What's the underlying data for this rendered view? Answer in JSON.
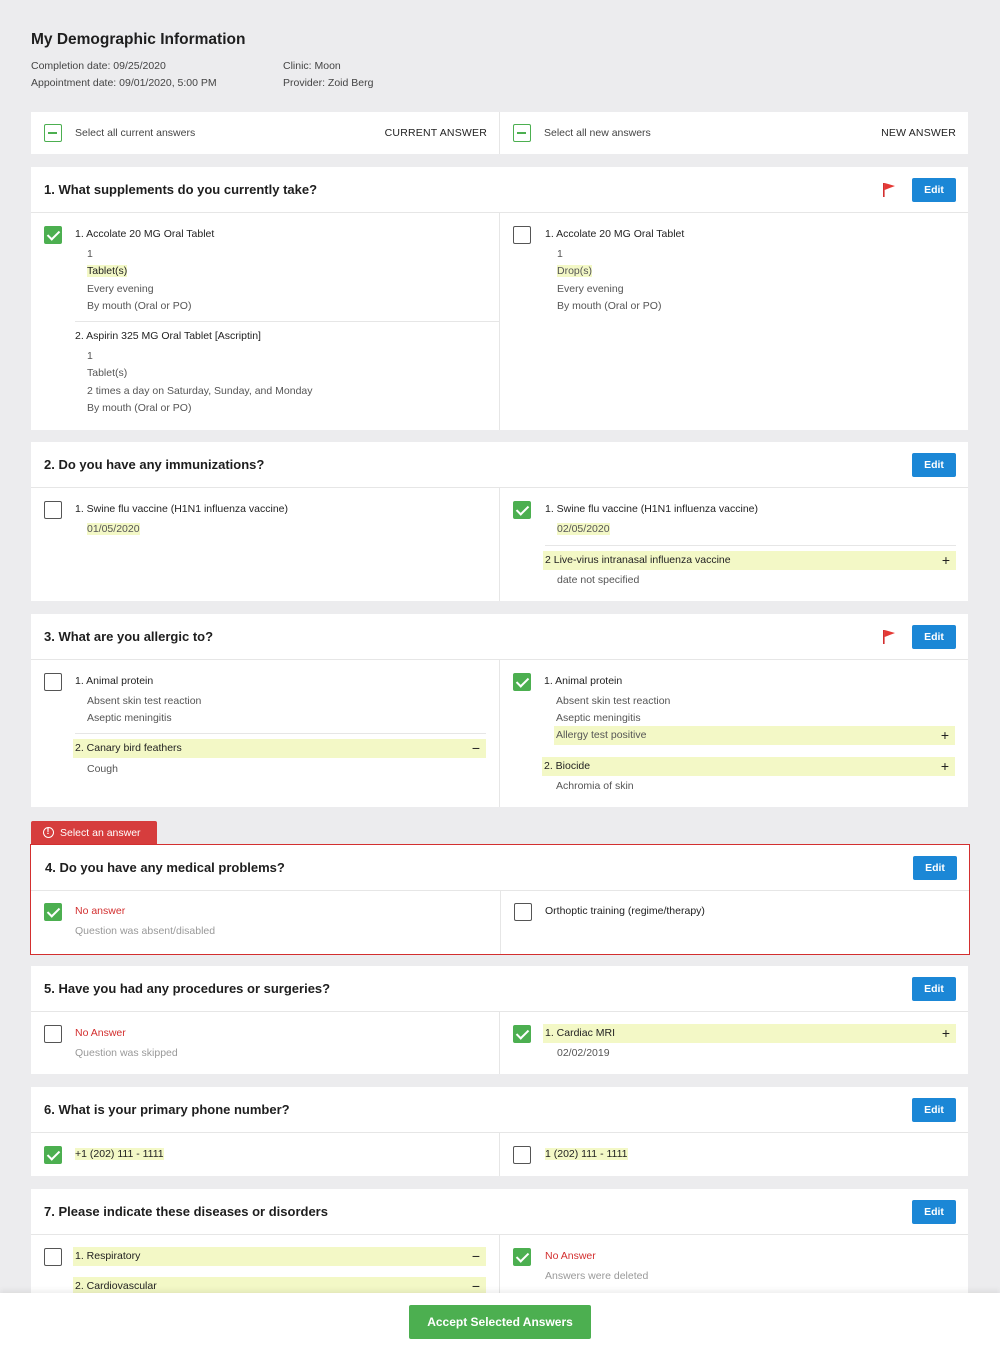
{
  "header": {
    "title": "My Demographic Information",
    "completion_date": "Completion date: 09/25/2020",
    "appointment_date": "Appointment date: 09/01/2020, 5:00 PM",
    "clinic": "Clinic: Moon",
    "provider": "Provider: Zoid Berg"
  },
  "select_bar": {
    "current_label": "Select all current answers",
    "current_tag": "CURRENT ANSWER",
    "new_label": "Select all new answers",
    "new_tag": "NEW ANSWER"
  },
  "edit_label": "Edit",
  "accept_label": "Accept Selected Answers",
  "error_tag": "Select an answer",
  "colors": {
    "accent": "#1b87d6",
    "check": "#4caf50",
    "error": "#d32f2f",
    "highlight": "#f3f8c6"
  },
  "q1": {
    "title": "1. What supplements do you currently take?",
    "cur": {
      "item1": {
        "name": "1.  Accolate 20 MG Oral Tablet",
        "qty": "1",
        "unit": "Tablet(s)",
        "freq": "Every evening",
        "route": "By mouth (Oral or PO)"
      },
      "item2": {
        "name": "2.  Aspirin 325 MG Oral Tablet [Ascriptin]",
        "qty": "1",
        "unit": "Tablet(s)",
        "freq": "2 times a day on Saturday, Sunday, and Monday",
        "route": "By mouth (Oral or PO)"
      }
    },
    "new": {
      "item1": {
        "name": "1.  Accolate 20 MG Oral Tablet",
        "qty": "1",
        "unit": "Drop(s)",
        "freq": "Every evening",
        "route": "By mouth (Oral or PO)"
      }
    }
  },
  "q2": {
    "title": "2. Do you have any immunizations?",
    "cur": {
      "name": "1.  Swine flu vaccine (H1N1 influenza vaccine)",
      "date": "01/05/2020"
    },
    "new": {
      "name": "1.  Swine flu vaccine (H1N1 influenza vaccine)",
      "date": "02/05/2020",
      "name2": "2  Live-virus intranasal influenza vaccine",
      "date2": "date not specified"
    }
  },
  "q3": {
    "title": "3. What are you allergic to?",
    "cur": {
      "name": "1.  Animal protein",
      "r1": "Absent skin test reaction",
      "r2": "Aseptic meningitis",
      "name2": "2.  Canary bird feathers",
      "r3": "Cough"
    },
    "new": {
      "name": "1.  Animal protein",
      "r1": "Absent skin test reaction",
      "r2": "Aseptic meningitis",
      "r3": "Allergy test positive",
      "name2": "2.  Biocide",
      "r4": "Achromia of skin"
    }
  },
  "q4": {
    "title": "4. Do you have any medical problems?",
    "cur": {
      "status": "No answer",
      "note": "Question was absent/disabled"
    },
    "new": {
      "name": "Orthoptic training (regime/therapy)"
    }
  },
  "q5": {
    "title": "5. Have you had any procedures or surgeries?",
    "cur": {
      "status": "No Answer",
      "note": "Question was skipped"
    },
    "new": {
      "name": "1.  Cardiac MRI",
      "date": "02/02/2019"
    }
  },
  "q6": {
    "title": "6. What is your primary phone number?",
    "cur": {
      "value": "+1 (202) 111 - 1111"
    },
    "new": {
      "value": "1 (202) 111 - 1111"
    }
  },
  "q7": {
    "title": "7. Please indicate these diseases or disorders",
    "cur": {
      "name": "1.  Respiratory",
      "name2": "2.  Cardiovascular"
    },
    "new": {
      "status": "No Answer",
      "note": "Answers were deleted"
    }
  },
  "symbols": {
    "plus": "+",
    "minus": "−"
  }
}
